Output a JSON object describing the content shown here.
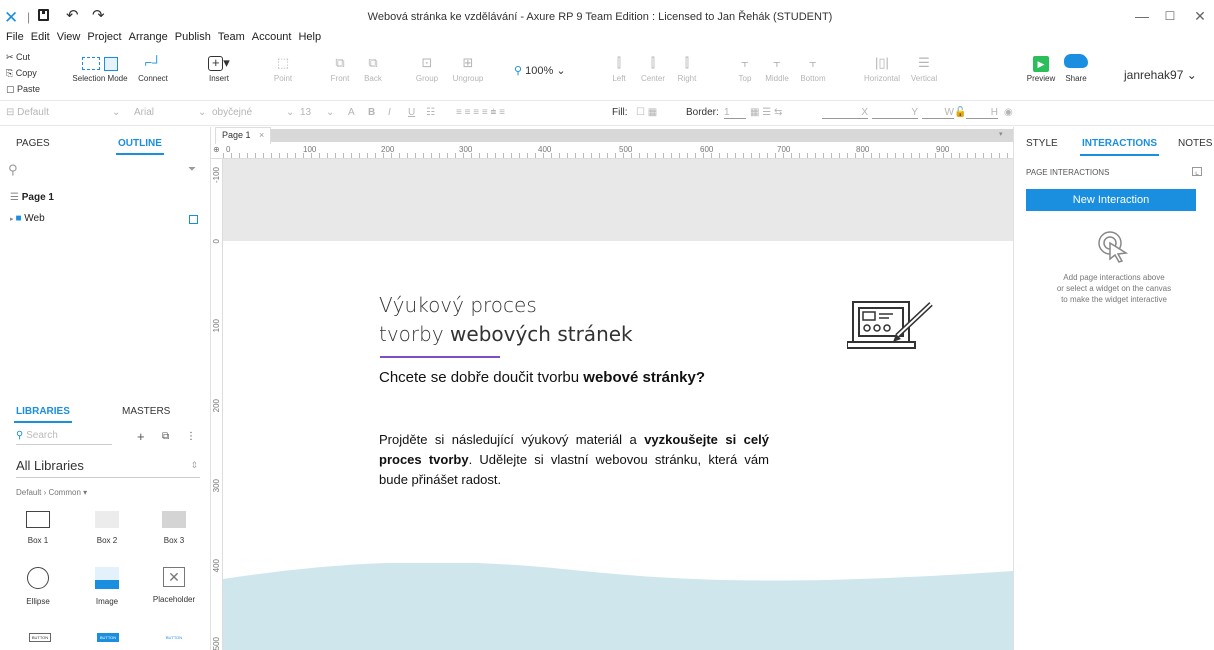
{
  "window": {
    "title": "Webová stránka ke vzdělávání - Axure RP 9 Team Edition : Licensed to Jan Řehák (STUDENT)",
    "minimize": "—",
    "maximize": "☐",
    "close": "✕"
  },
  "menu": [
    "File",
    "Edit",
    "View",
    "Project",
    "Arrange",
    "Publish",
    "Team",
    "Account",
    "Help"
  ],
  "toolbar": {
    "cut": "Cut",
    "copy": "Copy",
    "paste": "Paste",
    "selection_mode": "Selection Mode",
    "connect": "Connect",
    "insert": "Insert",
    "point": "Point",
    "front": "Front",
    "back": "Back",
    "group": "Group",
    "ungroup": "Ungroup",
    "zoom": "100%",
    "left": "Left",
    "center": "Center",
    "right": "Right",
    "top": "Top",
    "middle": "Middle",
    "bottom": "Bottom",
    "horizontal": "Horizontal",
    "vertical": "Vertical",
    "preview": "Preview",
    "share": "Share",
    "user": "janrehak97"
  },
  "format_bar": {
    "style": "Default",
    "font": "Arial",
    "weight": "obyčejné",
    "size": "13",
    "fill": "Fill:",
    "border": "Border:",
    "border_width": "1",
    "x": "X",
    "y": "Y",
    "w": "W",
    "h": "H"
  },
  "left_panel": {
    "tabs": [
      "PAGES",
      "OUTLINE"
    ],
    "active_tab": "OUTLINE",
    "outline": {
      "page": "Page 1",
      "folder": "Web"
    },
    "lib_tabs": [
      "LIBRARIES",
      "MASTERS"
    ],
    "search_placeholder": "Search",
    "library": "All Libraries",
    "breadcrumb": "Default › Common ▾",
    "widgets": [
      "Box 1",
      "Box 2",
      "Box 3",
      "Ellipse",
      "Image",
      "Placeholder"
    ],
    "button_labels": [
      "BUTTON",
      "BUTTON",
      "BUTTON"
    ]
  },
  "canvas": {
    "tab": "Page 1",
    "hruler": [
      "0",
      "100",
      "200",
      "300",
      "400",
      "500",
      "600",
      "700",
      "800",
      "900"
    ],
    "vruler": [
      "-100",
      "0",
      "100",
      "200",
      "300",
      "400",
      "500"
    ],
    "heading_line1": "Výukový proces",
    "heading_line2_plain": "tvorby ",
    "heading_line2_bold": "webových stránek",
    "subheading_plain": "Chcete se dobře doučit tvorbu ",
    "subheading_bold": "webové stránky?",
    "para_1": "Projděte si následující výukový materiál a ",
    "para_bold1": "vyzkoušejte si celý proces tvorby",
    "para_2": ". Udělejte si vlastní webovou stránku, která vám bude přinášet radost.",
    "accent_color": "#7a4fc8",
    "wave_color": "#cfe6ec"
  },
  "right_panel": {
    "tabs": [
      "STYLE",
      "INTERACTIONS",
      "NOTES"
    ],
    "active_tab": "INTERACTIONS",
    "section": "PAGE INTERACTIONS",
    "new_interaction": "New Interaction",
    "hint": [
      "Add page interactions above",
      "or select a widget on the canvas",
      "to make the widget interactive"
    ]
  },
  "colors": {
    "accent": "#1a8fe0",
    "preview": "#2bbf5b"
  }
}
